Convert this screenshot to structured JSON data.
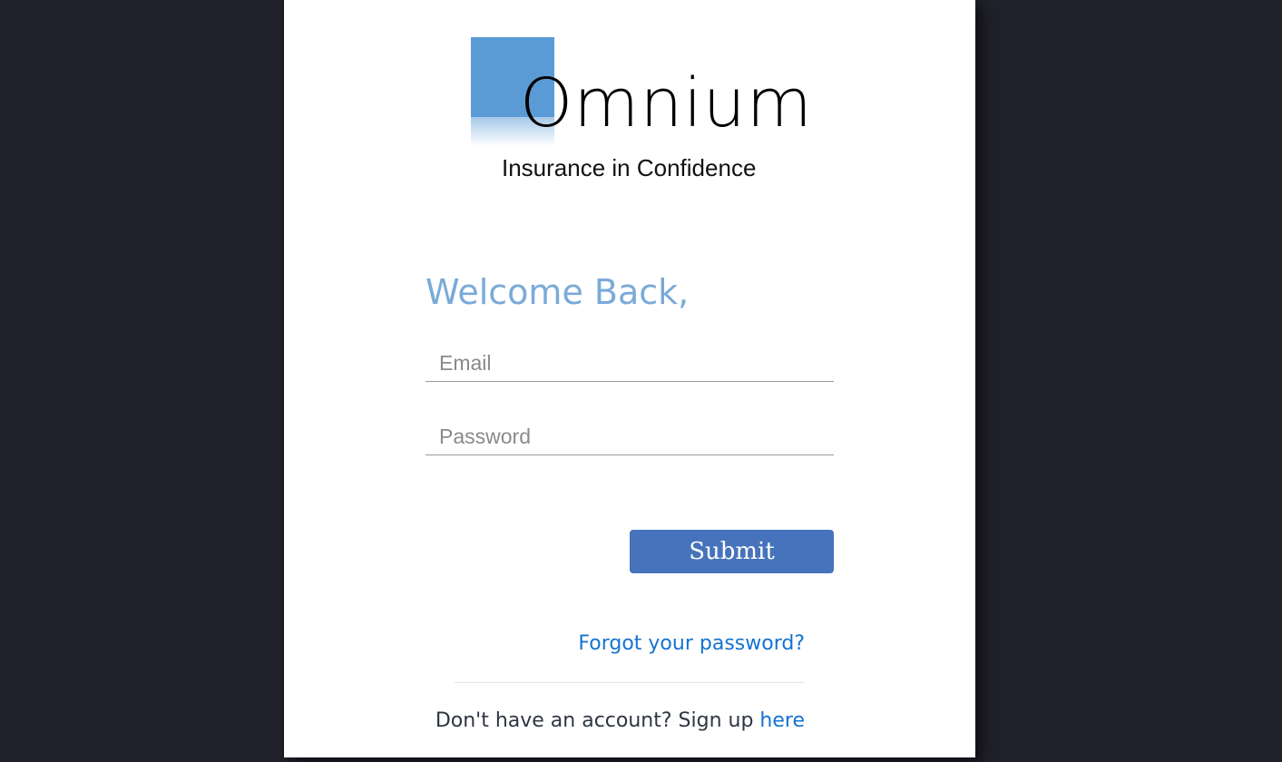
{
  "logo": {
    "wordmark": "Omnium",
    "tagline": "Insurance in Confidence",
    "brand_color": "#5b9bd5"
  },
  "form": {
    "heading": "Welcome Back,",
    "email_placeholder": "Email",
    "email_value": "",
    "password_placeholder": "Password",
    "password_value": "",
    "submit_label": "Submit",
    "submit_color": "#4673bb"
  },
  "links": {
    "forgot_password": "Forgot your password?",
    "signup_prompt": "Don't have an account? Sign up",
    "signup_link": "here",
    "link_color": "#1473d0"
  },
  "colors": {
    "background": "#21212b",
    "card": "#ffffff",
    "heading": "#7aaad8"
  }
}
